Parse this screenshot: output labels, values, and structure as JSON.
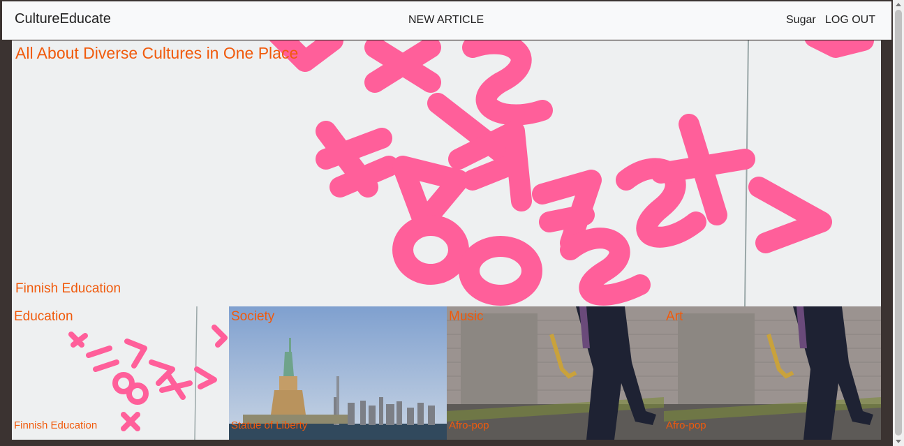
{
  "navbar": {
    "brand": "CultureEducate",
    "new_article": "NEW ARTICLE",
    "username": "Sugar",
    "logout": "LOG OUT"
  },
  "hero": {
    "title": "All About Diverse Cultures in One Place",
    "featured_article": "Finnish Education",
    "image": "pink-plastic-letters"
  },
  "categories": [
    {
      "name": "Education",
      "article": "Finnish Education",
      "image": "pink-plastic-letters"
    },
    {
      "name": "Society",
      "article": "Statue of Liberty",
      "image": "statue-of-liberty-skyline"
    },
    {
      "name": "Music",
      "article": "Afro-pop",
      "image": "saxophone-brick-wall"
    },
    {
      "name": "Art",
      "article": "Afro-pop",
      "image": "saxophone-brick-wall"
    }
  ],
  "colors": {
    "accent": "#f05a0c",
    "navbar_bg": "#f8f9fa",
    "page_bg": "#3b3331",
    "letters_pink": "#ff5f9a"
  }
}
